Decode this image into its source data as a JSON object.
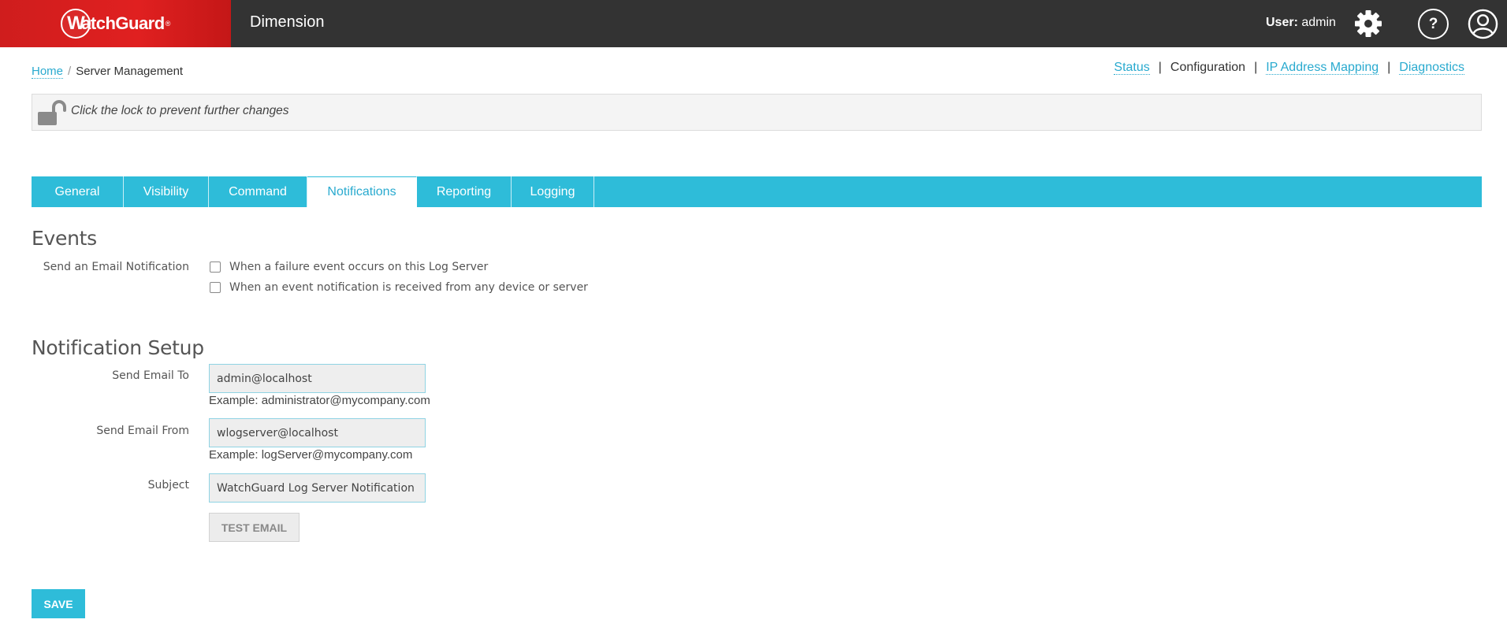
{
  "header": {
    "brand": "WatchGuard",
    "app_title": "Dimension",
    "user_prefix": "User:",
    "user_name": "admin"
  },
  "breadcrumb": {
    "home": "Home",
    "separator": "/",
    "current": "Server Management"
  },
  "top_links": {
    "status": "Status",
    "configuration": "Configuration",
    "ip_mapping": "IP Address Mapping",
    "diagnostics": "Diagnostics",
    "separator": "|"
  },
  "lock": {
    "message": "Click the lock to prevent further changes",
    "state": "unlocked"
  },
  "tabs": [
    {
      "label": "General",
      "active": false
    },
    {
      "label": "Visibility",
      "active": false
    },
    {
      "label": "Command",
      "active": false
    },
    {
      "label": "Notifications",
      "active": true
    },
    {
      "label": "Reporting",
      "active": false
    },
    {
      "label": "Logging",
      "active": false
    }
  ],
  "events": {
    "heading": "Events",
    "label": "Send an Email Notification",
    "options": [
      {
        "label": "When a failure event occurs on this Log Server",
        "checked": false
      },
      {
        "label": "When an event notification is received from any device or server",
        "checked": false
      }
    ]
  },
  "setup": {
    "heading": "Notification Setup",
    "send_to_label": "Send Email To",
    "send_to_value": "admin@localhost",
    "send_to_example": "Example: administrator@mycompany.com",
    "send_from_label": "Send Email From",
    "send_from_value": "wlogserver@localhost",
    "send_from_example": "Example: logServer@mycompany.com",
    "subject_label": "Subject",
    "subject_value": "WatchGuard Log Server Notification",
    "test_button": "TEST EMAIL"
  },
  "save_button": "SAVE",
  "colors": {
    "accent": "#2ebcd9",
    "brand_red": "#e02020",
    "topbar": "#333333"
  }
}
